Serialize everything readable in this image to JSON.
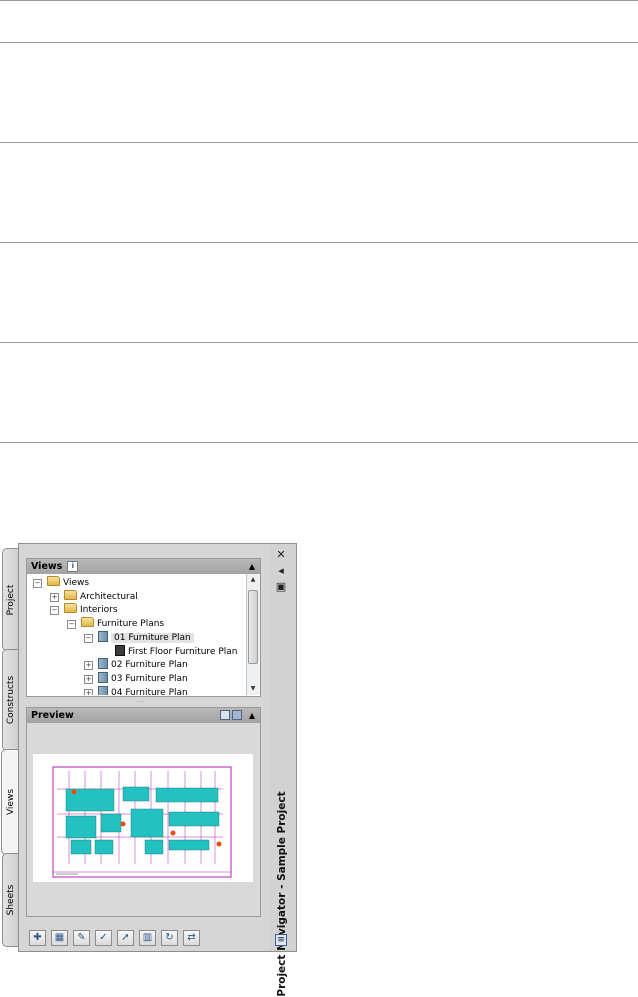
{
  "palette": {
    "title": "Project Navigator - Sample Project",
    "tabs": [
      "Project",
      "Constructs",
      "Views",
      "Sheets"
    ],
    "active_tab": "Views",
    "views_panel": {
      "title": "Views",
      "info_badge": "i",
      "tree": [
        {
          "label": "Views",
          "type": "folder",
          "expander": "minus"
        },
        {
          "label": "Architectural",
          "type": "folder",
          "expander": "plus"
        },
        {
          "label": "Interiors",
          "type": "folder",
          "expander": "minus"
        },
        {
          "label": "Furniture Plans",
          "type": "folder",
          "expander": "minus"
        },
        {
          "label": "01 Furniture Plan",
          "type": "view",
          "expander": "minus",
          "selected": true
        },
        {
          "label": "First Floor Furniture Plan",
          "type": "view-dark",
          "expander": "none"
        },
        {
          "label": "02 Furniture Plan",
          "type": "view",
          "expander": "plus"
        },
        {
          "label": "03 Furniture Plan",
          "type": "view",
          "expander": "plus"
        },
        {
          "label": "04 Furniture Plan",
          "type": "view",
          "expander": "plus"
        }
      ]
    },
    "preview_panel": {
      "title": "Preview"
    },
    "toolbar_icons": [
      "add-view-icon",
      "new-view-icon",
      "edit-view-icon",
      "regenerate-icon",
      "select-icon",
      "columns-icon",
      "refresh-icon",
      "reposition-icon"
    ]
  },
  "colors": {
    "plan_fill": "#23c1c1",
    "plan_frame": "#b020b0",
    "plan_accent": "#e05010"
  }
}
